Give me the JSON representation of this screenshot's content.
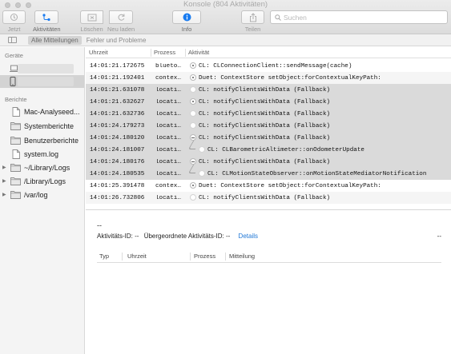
{
  "window": {
    "title": "Konsole (804 Aktivitäten)"
  },
  "toolbar": {
    "now_label": "Jetzt",
    "activities_label": "Aktivitäten",
    "clear_label": "Löschen",
    "reload_label": "Neu laden",
    "info_label": "Info",
    "share_label": "Teilen",
    "search_placeholder": "Suchen",
    "accent_color": "#1a7cf0"
  },
  "filterbar": {
    "all_messages": "Alle Mitteilungen",
    "errors_faults": "Fehler und Probleme"
  },
  "sidebar": {
    "devices_heading": "Geräte",
    "reports_heading": "Berichte",
    "items": [
      {
        "label": "Mac-Analyseed...",
        "icon": "document-icon"
      },
      {
        "label": "Systemberichte",
        "icon": "folder-icon"
      },
      {
        "label": "Benutzerberichte",
        "icon": "folder-icon"
      },
      {
        "label": "system.log",
        "icon": "document-icon"
      },
      {
        "label": "~/Library/Logs",
        "icon": "folder-icon"
      },
      {
        "label": "/Library/Logs",
        "icon": "folder-icon"
      },
      {
        "label": "/var/log",
        "icon": "folder-icon"
      }
    ]
  },
  "log": {
    "columns": {
      "time": "Uhrzeit",
      "process": "Prozess",
      "activity": "Aktivität"
    },
    "rows": [
      {
        "time": "14:01:21.172675",
        "process": "blueto…",
        "message": "CL: CLConnectionClient::sendMessage(cache)",
        "indicator": "filled",
        "depth": 0,
        "shade": "white"
      },
      {
        "time": "14:01:21.192401",
        "process": "contex…",
        "message": "Duet: ContextStore setObject:forContextualKeyPath:",
        "indicator": "filled",
        "depth": 0,
        "shade": "light"
      },
      {
        "time": "14:01:21.631078",
        "process": "locati…",
        "message": "CL: notifyClientsWithData (Fallback)",
        "indicator": "empty",
        "depth": 0,
        "shade": "grey"
      },
      {
        "time": "14:01:21.632627",
        "process": "locati…",
        "message": "CL: notifyClientsWithData (Fallback)",
        "indicator": "filled",
        "depth": 0,
        "shade": "grey"
      },
      {
        "time": "14:01:21.632736",
        "process": "locati…",
        "message": "CL: notifyClientsWithData (Fallback)",
        "indicator": "empty",
        "depth": 0,
        "shade": "grey"
      },
      {
        "time": "14:01:24.179273",
        "process": "locati…",
        "message": "CL: notifyClientsWithData (Fallback)",
        "indicator": "empty",
        "depth": 0,
        "shade": "grey"
      },
      {
        "time": "14:01:24.180120",
        "process": "locati…",
        "message": "CL: notifyClientsWithData (Fallback)",
        "indicator": "minus",
        "depth": 0,
        "shade": "grey"
      },
      {
        "time": "14:01:24.181007",
        "process": "locati…",
        "message": "CL: CLBarometricAltimeter::onOdometerUpdate",
        "indicator": "empty",
        "depth": 1,
        "shade": "grey"
      },
      {
        "time": "14:01:24.180176",
        "process": "locati…",
        "message": "CL: notifyClientsWithData (Fallback)",
        "indicator": "minus",
        "depth": 0,
        "shade": "grey"
      },
      {
        "time": "14:01:24.180535",
        "process": "locati…",
        "message": "CL: CLMotionStateObserver::onMotionStateMediatorNotification",
        "indicator": "empty",
        "depth": 1,
        "shade": "grey"
      },
      {
        "time": "14:01:25.391478",
        "process": "contex…",
        "message": "Duet: ContextStore setObject:forContextualKeyPath:",
        "indicator": "filled",
        "depth": 0,
        "shade": "white"
      },
      {
        "time": "14:01:26.732806",
        "process": "locati…",
        "message": "CL: notifyClientsWithData (Fallback)",
        "indicator": "empty",
        "depth": 0,
        "shade": "light"
      }
    ]
  },
  "detail": {
    "placeholder": "--",
    "activity_id_label": "Aktivitäts-ID:",
    "activity_id_value": "--",
    "parent_id_label": "Übergeordnete Aktivitäts-ID:",
    "parent_id_value": "--",
    "details_link": "Details",
    "right_value": "--",
    "columns": {
      "type": "Typ",
      "time": "Uhrzeit",
      "process": "Prozess",
      "message": "Mitteilung"
    }
  }
}
